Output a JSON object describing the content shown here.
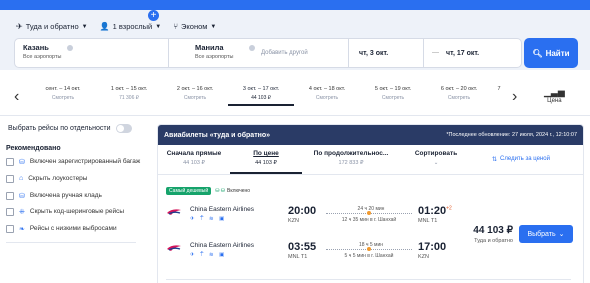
{
  "search": {
    "trip_type": "Туда и обратно",
    "passengers": "1 взрослый",
    "cabin": "Эконом",
    "from_city": "Казань",
    "from_sub": "Все аэропорты",
    "to_city": "Манила",
    "to_sub": "Все аэропорты",
    "add_other": "Добавить другой",
    "date_out": "чт, 3 окт.",
    "date_back": "чт, 17 окт.",
    "find_label": "Найти"
  },
  "date_strip": {
    "cells": [
      {
        "dates": "сент. – 14 окт.",
        "price": "Смотреть"
      },
      {
        "dates": "1 окт. – 15 окт.",
        "price": "71 306 ₽"
      },
      {
        "dates": "2 окт. – 16 окт.",
        "price": "Смотреть"
      },
      {
        "dates": "3 окт. – 17 окт.",
        "price": "44 103 ₽"
      },
      {
        "dates": "4 окт. – 18 окт.",
        "price": "Смотреть"
      },
      {
        "dates": "5 окт. – 19 окт.",
        "price": "Смотреть"
      },
      {
        "dates": "6 окт. – 20 окт.",
        "price": "Смотреть"
      },
      {
        "dates": "7",
        "price": ""
      }
    ],
    "price_label": "Цена"
  },
  "filters": {
    "toggle_label": "Выбрать рейсы по отдельности",
    "recommended": "Рекомендовано",
    "items": [
      "Включен зарегистрированный багаж",
      "Скрыть лоукостеры",
      "Включена ручная кладь",
      "Скрыть код-шеринговые рейсы",
      "Рейсы с низкими выбросами"
    ]
  },
  "results": {
    "header_title": "Авиабилеты «туда и обратно»",
    "updated": "*Последнее обновление: 27 июля, 2024 г., 12:10:07",
    "sorts": [
      {
        "label": "Сначала прямые",
        "value": "44 103 ₽"
      },
      {
        "label": "По цене",
        "value": "44 103 ₽"
      },
      {
        "label": "По продолжительнос...",
        "value": "172 833 ₽"
      },
      {
        "label": "Сортировать",
        "value": ""
      }
    ],
    "follow_price": "Следить за ценой",
    "badge_cheapest": "Самый дешевый",
    "badge_luggage": "Включено",
    "segments": [
      {
        "airline": "China Eastern Airlines",
        "dep_time": "20:00",
        "dep_code": "KZN",
        "duration": "24 ч 20 мин",
        "transfer": "12 ч 35 мин в г. Шанхай",
        "arr_time": "01:20",
        "arr_plus": "+2",
        "arr_code": "MNL T1"
      },
      {
        "airline": "China Eastern Airlines",
        "dep_time": "03:55",
        "dep_code": "MNL T1",
        "duration": "18 ч 5 мин",
        "transfer": "5 ч 5 мин в г. Шанхай",
        "arr_time": "17:00",
        "arr_plus": "",
        "arr_code": "KZN"
      }
    ],
    "price": "44 103 ₽",
    "price_note": "Туда и обратно",
    "choose_label": "Выбрать"
  },
  "colors": {
    "accent": "#2a6ff0",
    "header": "#2a3b66",
    "green": "#16a36b"
  }
}
